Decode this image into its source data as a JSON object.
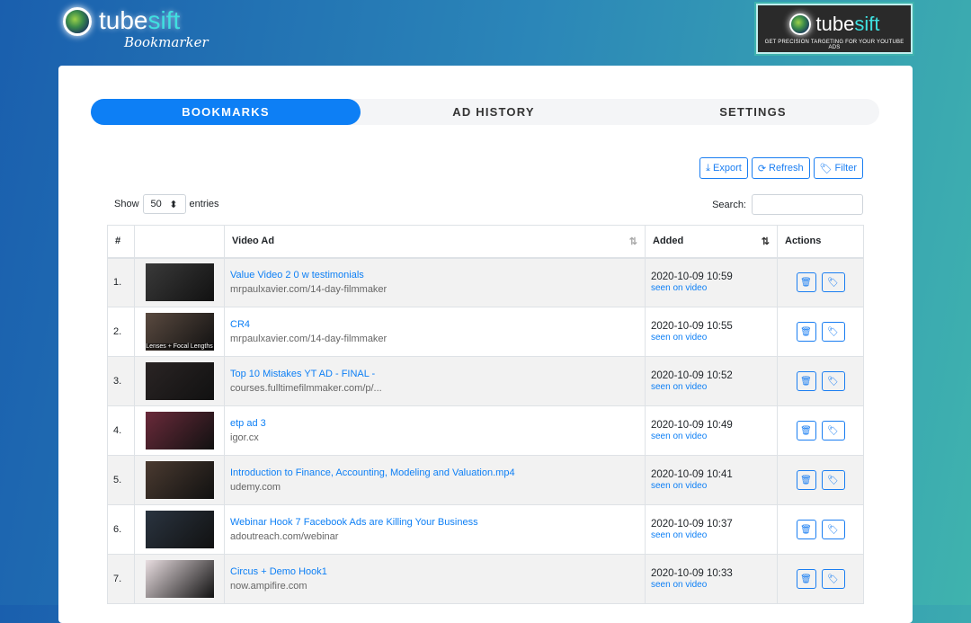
{
  "header": {
    "logo_word_a": "tube",
    "logo_word_b": "sift",
    "logo_sub": "Bookmarker",
    "banner_word_a": "tube",
    "banner_word_b": "sift",
    "banner_tag": "GET PRECISION TARGETING FOR YOUR YOUTUBE ADS"
  },
  "tabs": [
    {
      "label": "BOOKMARKS",
      "active": true
    },
    {
      "label": "AD HISTORY"
    },
    {
      "label": "SETTINGS"
    }
  ],
  "toolbar": {
    "export": "Export",
    "refresh": "Refresh",
    "filter": "Filter"
  },
  "length": {
    "show": "Show",
    "value": "50",
    "entries": "entries"
  },
  "search": {
    "label": "Search:",
    "value": ""
  },
  "columns": [
    "#",
    "",
    "Video Ad",
    "Added",
    "Actions"
  ],
  "rows": [
    {
      "n": "1.",
      "title": "Value Video 2 0 w testimonials",
      "domain": "mrpaulxavier.com/14-day-filmmaker",
      "added": "2020-10-09 10:59",
      "seen": "seen on video",
      "thumb_color": "#3a3a3a",
      "caption": ""
    },
    {
      "n": "2.",
      "title": "CR4",
      "domain": "mrpaulxavier.com/14-day-filmmaker",
      "added": "2020-10-09 10:55",
      "seen": "seen on video",
      "thumb_color": "#5a4a40",
      "caption": "Lenses + Focal Lengths"
    },
    {
      "n": "3.",
      "title": "Top 10 Mistakes YT AD - FINAL -",
      "domain": "courses.fulltimefilmmaker.com/p/...",
      "added": "2020-10-09 10:52",
      "seen": "seen on video",
      "thumb_color": "#2a2424",
      "caption": ""
    },
    {
      "n": "4.",
      "title": "etp ad 3",
      "domain": "igor.cx",
      "added": "2020-10-09 10:49",
      "seen": "seen on video",
      "thumb_color": "#6a2a3a",
      "caption": ""
    },
    {
      "n": "5.",
      "title": "Introduction to Finance, Accounting, Modeling and Valuation.mp4",
      "domain": "udemy.com",
      "added": "2020-10-09 10:41",
      "seen": "seen on video",
      "thumb_color": "#4a3a30",
      "caption": ""
    },
    {
      "n": "6.",
      "title": "Webinar Hook 7 Facebook Ads are Killing Your Business",
      "domain": "adoutreach.com/webinar",
      "added": "2020-10-09 10:37",
      "seen": "seen on video",
      "thumb_color": "#2a3440",
      "caption": ""
    },
    {
      "n": "7.",
      "title": "Circus + Demo Hook1",
      "domain": "now.ampifire.com",
      "added": "2020-10-09 10:33",
      "seen": "seen on video",
      "thumb_color": "#e8dde0",
      "caption": ""
    }
  ]
}
